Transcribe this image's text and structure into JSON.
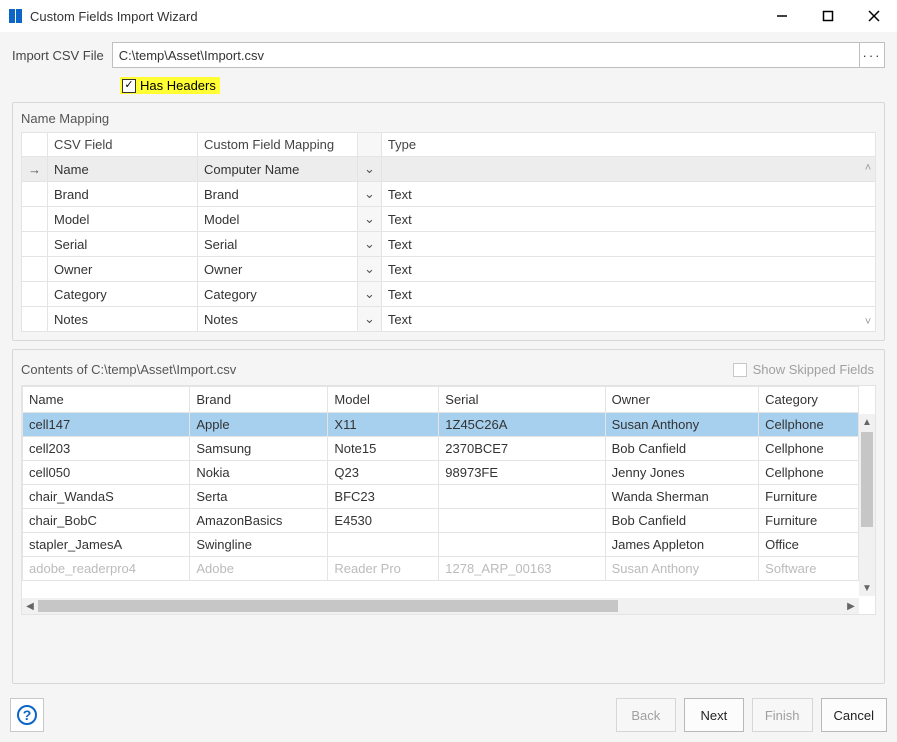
{
  "window": {
    "title": "Custom Fields Import Wizard"
  },
  "file": {
    "label": "Import CSV File",
    "path": "C:\\temp\\Asset\\Import.csv",
    "browse_glyph": "···",
    "has_headers_label": "Has Headers",
    "has_headers_checked": true
  },
  "mapping": {
    "legend": "Name Mapping",
    "headers": {
      "csv": "CSV Field",
      "custom": "Custom Field Mapping",
      "type": "Type"
    },
    "rows": [
      {
        "csv": "Name",
        "custom": "Computer Name",
        "type": "",
        "selected": true
      },
      {
        "csv": "Brand",
        "custom": "Brand",
        "type": "Text",
        "selected": false
      },
      {
        "csv": "Model",
        "custom": "Model",
        "type": "Text",
        "selected": false
      },
      {
        "csv": "Serial",
        "custom": "Serial",
        "type": "Text",
        "selected": false
      },
      {
        "csv": "Owner",
        "custom": "Owner",
        "type": "Text",
        "selected": false
      },
      {
        "csv": "Category",
        "custom": "Category",
        "type": "Text",
        "selected": false
      },
      {
        "csv": "Notes",
        "custom": "Notes",
        "type": "Text",
        "selected": false
      }
    ],
    "indicator_glyph": "→",
    "dropdown_glyph": "⌄"
  },
  "contents": {
    "legend_prefix": "Contents of ",
    "path": "C:\\temp\\Asset\\Import.csv",
    "show_skipped_label": "Show Skipped Fields",
    "headers": [
      "Name",
      "Brand",
      "Model",
      "Serial",
      "Owner",
      "Category"
    ],
    "rows": [
      {
        "c": [
          "cell147",
          "Apple",
          "X11",
          "1Z45C26A",
          "Susan Anthony",
          "Cellphone"
        ],
        "selected": true
      },
      {
        "c": [
          "cell203",
          "Samsung",
          "Note15",
          "2370BCE7",
          "Bob Canfield",
          "Cellphone"
        ],
        "selected": false
      },
      {
        "c": [
          "cell050",
          "Nokia",
          "Q23",
          "98973FE",
          "Jenny Jones",
          "Cellphone"
        ],
        "selected": false
      },
      {
        "c": [
          "chair_WandaS",
          "Serta",
          "BFC23",
          "",
          "Wanda Sherman",
          "Furniture"
        ],
        "selected": false
      },
      {
        "c": [
          "chair_BobC",
          "AmazonBasics",
          "E4530",
          "",
          "Bob Canfield",
          "Furniture"
        ],
        "selected": false
      },
      {
        "c": [
          "stapler_JamesA",
          "Swingline",
          "",
          "",
          "James Appleton",
          "Office"
        ],
        "selected": false
      },
      {
        "c": [
          "adobe_readerpro4",
          "Adobe",
          "Reader Pro",
          "1278_ARP_00163",
          "Susan Anthony",
          "Software"
        ],
        "selected": false,
        "clipped": true
      }
    ]
  },
  "footer": {
    "back": "Back",
    "next": "Next",
    "finish": "Finish",
    "cancel": "Cancel"
  }
}
